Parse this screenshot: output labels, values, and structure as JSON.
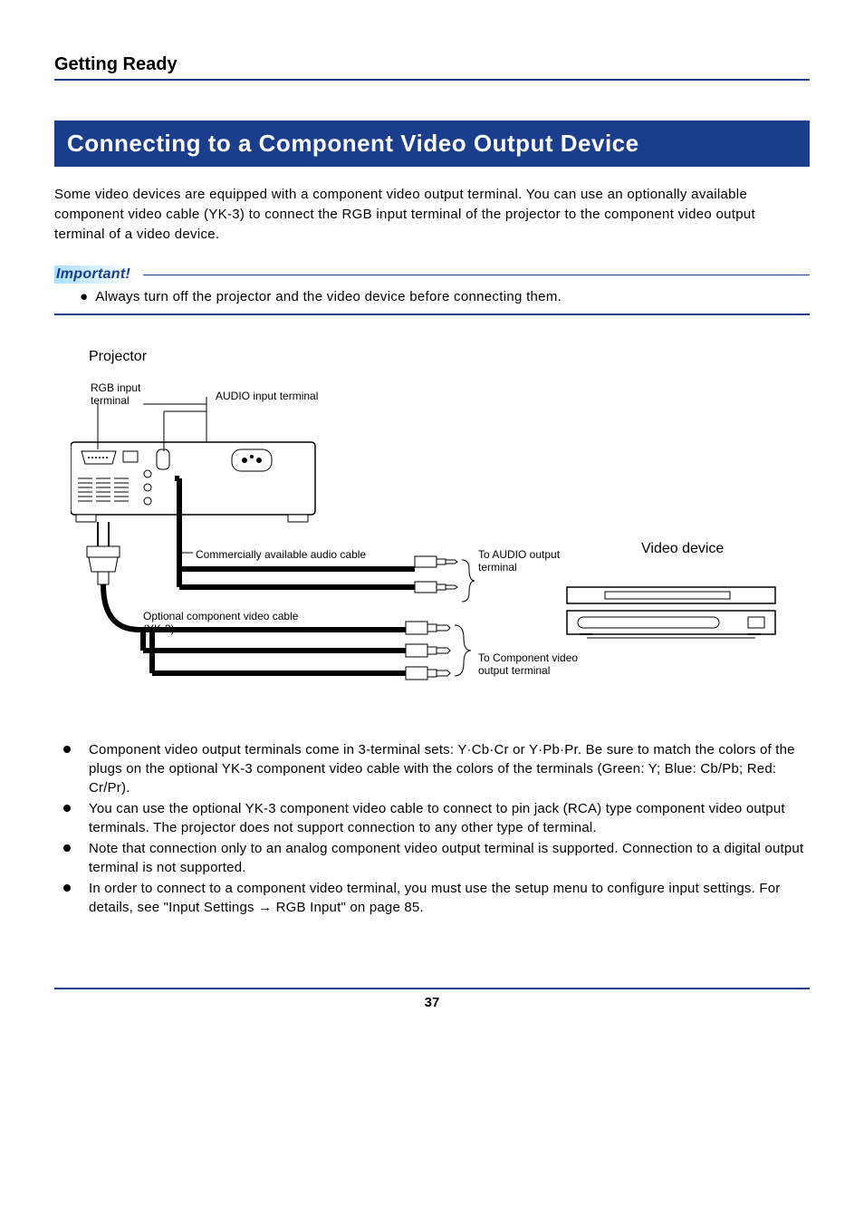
{
  "section_header": "Getting Ready",
  "title": "Connecting to a Component Video Output Device",
  "intro": "Some video devices are equipped with a component video output terminal. You can use an optionally available component video cable (YK-3) to connect the RGB input terminal of the projector to the component video output terminal of a video device.",
  "important_label": "Important!",
  "important_bullet": "Always turn off the projector and the video device before connecting them.",
  "diagram": {
    "projector_title": "Projector",
    "rgb_input": "RGB input\nterminal",
    "audio_input": "AUDIO input terminal",
    "audio_cable": "Commercially available audio cable",
    "to_audio_output": "To AUDIO output\nterminal",
    "video_device": "Video device",
    "component_cable": "Optional component video cable\n(YK-3)",
    "to_component_output": "To Component video\noutput terminal"
  },
  "bullets": [
    "Component video output terminals come in 3-terminal sets: Y·Cb·Cr or Y·Pb·Pr. Be sure to match the colors of the plugs on the optional YK-3 component video cable with the colors of the terminals (Green: Y; Blue: Cb/Pb; Red: Cr/Pr).",
    "You can use the optional YK-3 component video cable to connect to pin jack (RCA) type component video output terminals. The projector does not support connection to any other type of terminal.",
    "Note that connection only to an analog component video output terminal is supported. Connection to a digital output terminal is not supported.",
    "In order to connect to a component video terminal, you must use the setup menu to configure input settings. For details, see \"Input Settings → RGB Input\" on page 85."
  ],
  "page_number": "37"
}
